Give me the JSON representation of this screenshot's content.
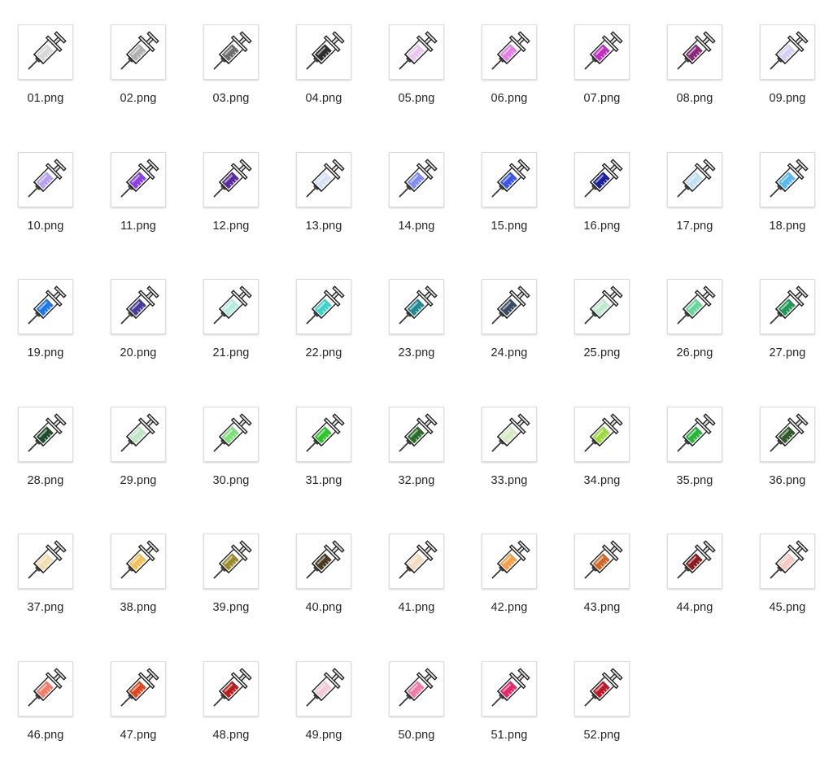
{
  "files": [
    {
      "name": "01.png",
      "color": "#d8d8d8"
    },
    {
      "name": "02.png",
      "color": "#b0b0b0"
    },
    {
      "name": "03.png",
      "color": "#6e6e6e"
    },
    {
      "name": "04.png",
      "color": "#2e2e2e"
    },
    {
      "name": "05.png",
      "color": "#ecc6ec"
    },
    {
      "name": "06.png",
      "color": "#e77ee7"
    },
    {
      "name": "07.png",
      "color": "#c02fc0"
    },
    {
      "name": "08.png",
      "color": "#8a2a7a"
    },
    {
      "name": "09.png",
      "color": "#d8d0f4"
    },
    {
      "name": "10.png",
      "color": "#b6a0f0"
    },
    {
      "name": "11.png",
      "color": "#8a3ee6"
    },
    {
      "name": "12.png",
      "color": "#5a2aa0"
    },
    {
      "name": "13.png",
      "color": "#d6e2f8"
    },
    {
      "name": "14.png",
      "color": "#7f8ff2"
    },
    {
      "name": "15.png",
      "color": "#3b56e6"
    },
    {
      "name": "16.png",
      "color": "#1c1f9a"
    },
    {
      "name": "17.png",
      "color": "#bfe0f2"
    },
    {
      "name": "18.png",
      "color": "#5ab8f0"
    },
    {
      "name": "19.png",
      "color": "#1f76e8"
    },
    {
      "name": "20.png",
      "color": "#443d9a"
    },
    {
      "name": "21.png",
      "color": "#b6ece0"
    },
    {
      "name": "22.png",
      "color": "#3fd2c8"
    },
    {
      "name": "23.png",
      "color": "#1f8a92"
    },
    {
      "name": "24.png",
      "color": "#3b4d64"
    },
    {
      "name": "25.png",
      "color": "#bfe8cf"
    },
    {
      "name": "26.png",
      "color": "#68d69a"
    },
    {
      "name": "27.png",
      "color": "#1e9a56"
    },
    {
      "name": "28.png",
      "color": "#1f4d2a"
    },
    {
      "name": "29.png",
      "color": "#bfe6c2"
    },
    {
      "name": "30.png",
      "color": "#7ee07a"
    },
    {
      "name": "31.png",
      "color": "#2ec42a"
    },
    {
      "name": "32.png",
      "color": "#2a6e2a"
    },
    {
      "name": "33.png",
      "color": "#d6eac2"
    },
    {
      "name": "34.png",
      "color": "#9ada3a"
    },
    {
      "name": "35.png",
      "color": "#28b43a"
    },
    {
      "name": "36.png",
      "color": "#2f5a2a"
    },
    {
      "name": "37.png",
      "color": "#f2dcb0"
    },
    {
      "name": "38.png",
      "color": "#f2c05a"
    },
    {
      "name": "39.png",
      "color": "#9a8a2e"
    },
    {
      "name": "40.png",
      "color": "#4a3a22"
    },
    {
      "name": "41.png",
      "color": "#f2dcc0"
    },
    {
      "name": "42.png",
      "color": "#f4a04a"
    },
    {
      "name": "43.png",
      "color": "#d2662a"
    },
    {
      "name": "44.png",
      "color": "#8a1e1e"
    },
    {
      "name": "45.png",
      "color": "#f6c8c0"
    },
    {
      "name": "46.png",
      "color": "#f47a6a"
    },
    {
      "name": "47.png",
      "color": "#e0461e"
    },
    {
      "name": "48.png",
      "color": "#b81e1e"
    },
    {
      "name": "49.png",
      "color": "#f4c8d6"
    },
    {
      "name": "50.png",
      "color": "#f07aa8"
    },
    {
      "name": "51.png",
      "color": "#e0286a"
    },
    {
      "name": "52.png",
      "color": "#b81a2a"
    }
  ]
}
